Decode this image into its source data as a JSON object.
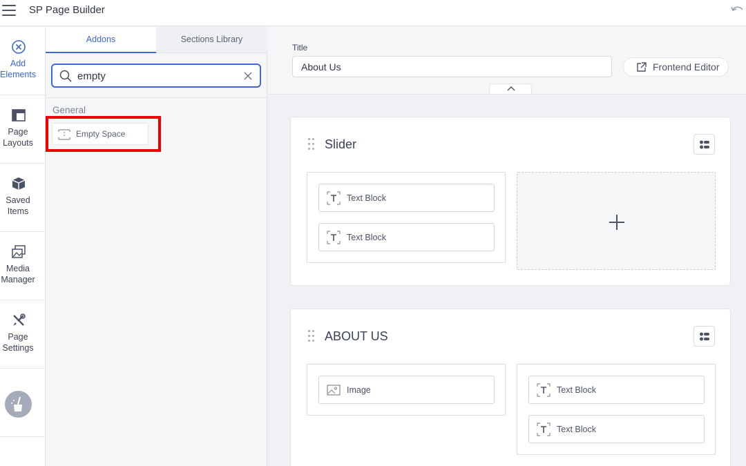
{
  "app": {
    "title": "SP Page Builder",
    "menu_icon": "hamburger-menu-icon",
    "undo_icon": "undo-icon"
  },
  "rail": {
    "items": [
      {
        "label": "Add Elements",
        "icon": "add-circle-icon",
        "active": true
      },
      {
        "label": "Page Layouts",
        "icon": "layout-icon"
      },
      {
        "label": "Saved Items",
        "icon": "box-icon"
      },
      {
        "label": "Media Manager",
        "icon": "images-icon"
      },
      {
        "label": "Page Settings",
        "icon": "tools-icon"
      }
    ],
    "avatar_icon": "broom-icon"
  },
  "addons_panel": {
    "tabs": [
      {
        "label": "Addons",
        "active": true
      },
      {
        "label": "Sections Library",
        "active": false
      }
    ],
    "search": {
      "value": "empty",
      "icon": "search-icon",
      "clear_icon": "close-icon"
    },
    "group_label": "General",
    "results": [
      {
        "label": "Empty Space",
        "icon": "empty-space-icon",
        "highlighted": true
      }
    ],
    "highlight_color": "#ef0000"
  },
  "main": {
    "title_label": "Title",
    "title_value": "About Us",
    "frontend_editor_label": "Frontend Editor",
    "frontend_editor_icon": "external-link-icon",
    "collapse_icon": "chevron-up-icon",
    "sections": [
      {
        "title": "Slider",
        "columns": [
          {
            "blocks": [
              {
                "label": "Text Block",
                "icon": "text-block-icon"
              },
              {
                "label": "Text Block",
                "icon": "text-block-icon"
              }
            ]
          },
          {
            "empty": true,
            "add_icon": "plus-icon"
          }
        ]
      },
      {
        "title": "ABOUT US",
        "columns": [
          {
            "blocks": [
              {
                "label": "Image",
                "icon": "image-icon"
              }
            ]
          },
          {
            "blocks": [
              {
                "label": "Text Block",
                "icon": "text-block-icon"
              },
              {
                "label": "Text Block",
                "icon": "text-block-icon"
              }
            ]
          }
        ]
      }
    ]
  },
  "colors": {
    "accent": "#3d66d6",
    "text": "#3a4255",
    "canvas": "#f0f1f4"
  }
}
